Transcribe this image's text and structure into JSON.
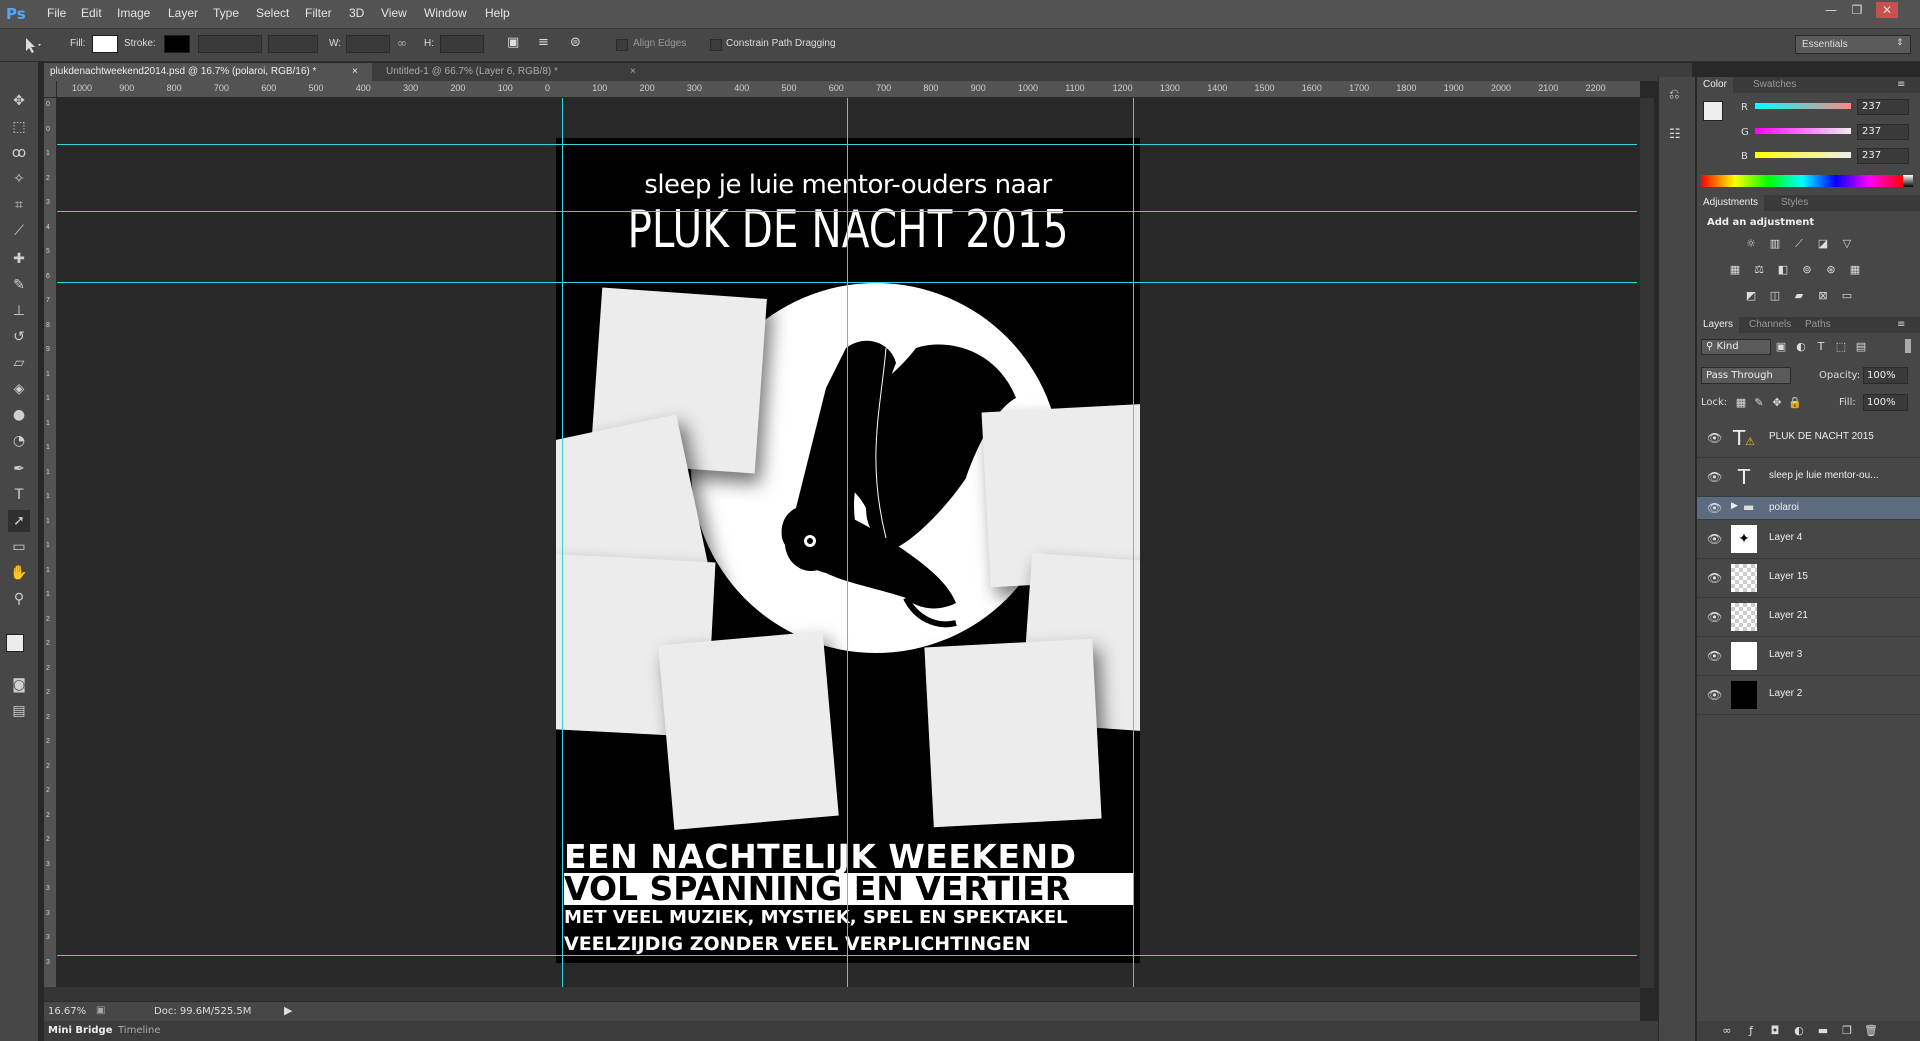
{
  "app": {
    "logo": "Ps",
    "menu": [
      "File",
      "Edit",
      "Image",
      "Layer",
      "Type",
      "Select",
      "Filter",
      "3D",
      "View",
      "Window",
      "Help"
    ],
    "workspace": "Essentials"
  },
  "window_controls": {
    "minimize": "—",
    "restore": "❐",
    "close": "✕"
  },
  "options": {
    "fill_label": "Fill:",
    "stroke_label": "Stroke:",
    "w_label": "W:",
    "h_label": "H:",
    "align_edges": "Align Edges",
    "constrain_path": "Constrain Path Dragging",
    "fill_color": "#ffffff",
    "stroke_color": "#000000"
  },
  "tabs": [
    {
      "label": "plukdenachtweekend2014.psd @ 16.7% (polaroi, RGB/16) *",
      "close": "×",
      "active": true
    },
    {
      "label": "Untitled-1 @ 66.7% (Layer 6, RGB/8) *",
      "close": "×",
      "active": false
    }
  ],
  "ruler_h": [
    "1000",
    "900",
    "800",
    "700",
    "600",
    "500",
    "400",
    "300",
    "200",
    "100",
    "0",
    "100",
    "200",
    "300",
    "400",
    "500",
    "600",
    "700",
    "800",
    "900",
    "1000",
    "1100",
    "1200",
    "1300",
    "1400",
    "1500",
    "1600",
    "1700",
    "1800",
    "1900",
    "2000",
    "2100",
    "2200"
  ],
  "ruler_v": [
    "0",
    "0",
    "100",
    "200",
    "300",
    "400",
    "500",
    "600",
    "700",
    "800",
    "900",
    "1000",
    "1100",
    "1200",
    "1300",
    "1400",
    "1500",
    "1600",
    "1700",
    "1800",
    "1900",
    "2000",
    "2100",
    "2200",
    "2300",
    "2400",
    "2500",
    "2600",
    "2700",
    "2800",
    "2900",
    "3000",
    "3100",
    "3200",
    "3300",
    "3400"
  ],
  "poster": {
    "subtitle": "sleep je luie mentor-ouders naar",
    "title": "PLUK DE NACHT 2015",
    "line1": "EEN NACHTELIJK WEEKEND",
    "line2": "VOL SPANNING EN VERTIER",
    "line3": "MET VEEL MUZIEK, MYSTIEK, SPEL EN SPEKTAKEL",
    "line4": "VEELZIJDIG ZONDER VEEL VERPLICHTINGEN"
  },
  "status": {
    "zoom": "16.67%",
    "doc": "Doc: 99.6M/525.5M"
  },
  "bottom_tabs": [
    "Mini Bridge",
    "Timeline"
  ],
  "color_panel": {
    "tabs": [
      "Color",
      "Swatches"
    ],
    "channels": [
      {
        "label": "R",
        "value": "237"
      },
      {
        "label": "G",
        "value": "237"
      },
      {
        "label": "B",
        "value": "237"
      }
    ]
  },
  "adjust_panel": {
    "tabs": [
      "Adjustments",
      "Styles"
    ],
    "heading": "Add an adjustment"
  },
  "layers_panel": {
    "tabs": [
      "Layers",
      "Channels",
      "Paths"
    ],
    "kind": "Kind",
    "blend": "Pass Through",
    "opacity_label": "Opacity:",
    "opacity": "100%",
    "lock_label": "Lock:",
    "fill_label": "Fill:",
    "fill": "100%",
    "layers": [
      {
        "name": "PLUK DE NACHT 2015",
        "type": "text-warn"
      },
      {
        "name": "sleep je luie mentor-ou...",
        "type": "text"
      },
      {
        "name": "polaroi",
        "type": "group",
        "selected": true
      },
      {
        "name": "Layer 4",
        "type": "owl"
      },
      {
        "name": "Layer 15",
        "type": "checker"
      },
      {
        "name": "Layer 21",
        "type": "checker"
      },
      {
        "name": "Layer 3",
        "type": "white"
      },
      {
        "name": "Layer 2",
        "type": "black"
      }
    ]
  }
}
